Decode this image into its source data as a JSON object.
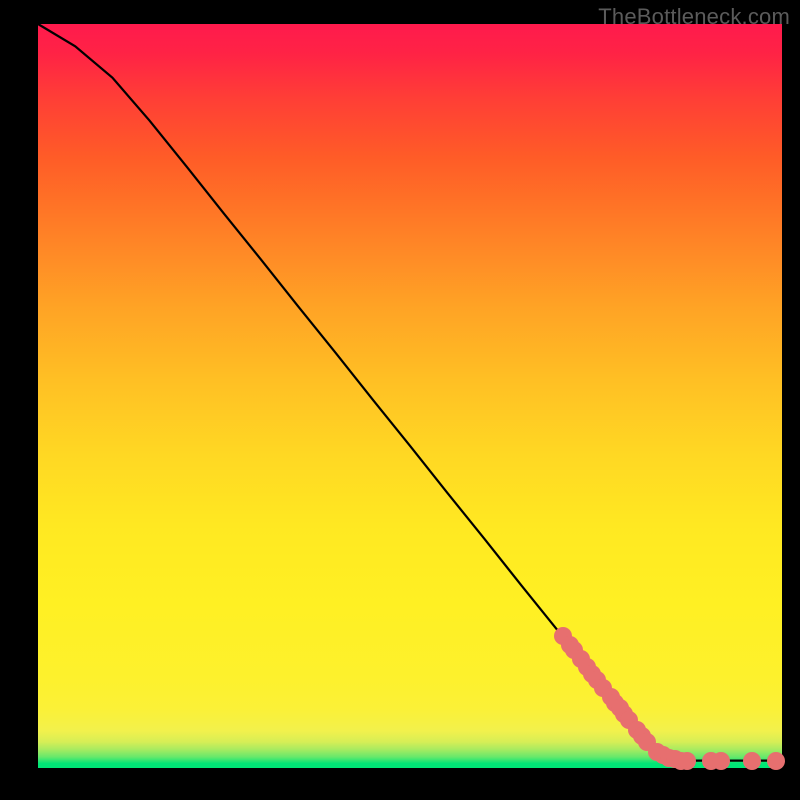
{
  "watermark": "TheBottleneck.com",
  "chart_data": {
    "type": "line",
    "title": "",
    "xlabel": "",
    "ylabel": "",
    "xlim": [
      0,
      1
    ],
    "ylim": [
      0,
      1
    ],
    "background_gradient": {
      "bottom": "#00e676",
      "mid_low": "#fff023",
      "mid": "#ffa325",
      "top": "#ff1a4d"
    },
    "curve": [
      {
        "x": 0.0,
        "y": 1.0
      },
      {
        "x": 0.05,
        "y": 0.97
      },
      {
        "x": 0.1,
        "y": 0.928
      },
      {
        "x": 0.15,
        "y": 0.87
      },
      {
        "x": 0.2,
        "y": 0.808
      },
      {
        "x": 0.25,
        "y": 0.745
      },
      {
        "x": 0.3,
        "y": 0.683
      },
      {
        "x": 0.35,
        "y": 0.62
      },
      {
        "x": 0.4,
        "y": 0.558
      },
      {
        "x": 0.45,
        "y": 0.495
      },
      {
        "x": 0.5,
        "y": 0.433
      },
      {
        "x": 0.55,
        "y": 0.37
      },
      {
        "x": 0.6,
        "y": 0.308
      },
      {
        "x": 0.65,
        "y": 0.245
      },
      {
        "x": 0.7,
        "y": 0.183
      },
      {
        "x": 0.75,
        "y": 0.12
      },
      {
        "x": 0.8,
        "y": 0.058
      },
      {
        "x": 0.83,
        "y": 0.025
      },
      {
        "x": 0.86,
        "y": 0.01
      },
      {
        "x": 0.89,
        "y": 0.01
      },
      {
        "x": 0.92,
        "y": 0.01
      },
      {
        "x": 0.96,
        "y": 0.01
      },
      {
        "x": 1.0,
        "y": 0.01
      }
    ],
    "markers": [
      {
        "x": 0.705,
        "y": 0.177
      },
      {
        "x": 0.715,
        "y": 0.165
      },
      {
        "x": 0.72,
        "y": 0.158
      },
      {
        "x": 0.73,
        "y": 0.146
      },
      {
        "x": 0.738,
        "y": 0.136
      },
      {
        "x": 0.745,
        "y": 0.127
      },
      {
        "x": 0.752,
        "y": 0.118
      },
      {
        "x": 0.76,
        "y": 0.108
      },
      {
        "x": 0.77,
        "y": 0.095
      },
      {
        "x": 0.776,
        "y": 0.087
      },
      {
        "x": 0.782,
        "y": 0.08
      },
      {
        "x": 0.788,
        "y": 0.073
      },
      {
        "x": 0.795,
        "y": 0.064
      },
      {
        "x": 0.805,
        "y": 0.051
      },
      {
        "x": 0.812,
        "y": 0.043
      },
      {
        "x": 0.818,
        "y": 0.035
      },
      {
        "x": 0.832,
        "y": 0.022
      },
      {
        "x": 0.84,
        "y": 0.018
      },
      {
        "x": 0.848,
        "y": 0.014
      },
      {
        "x": 0.856,
        "y": 0.012
      },
      {
        "x": 0.864,
        "y": 0.01
      },
      {
        "x": 0.872,
        "y": 0.01
      },
      {
        "x": 0.905,
        "y": 0.01
      },
      {
        "x": 0.918,
        "y": 0.01
      },
      {
        "x": 0.96,
        "y": 0.01
      },
      {
        "x": 0.992,
        "y": 0.01
      }
    ]
  }
}
